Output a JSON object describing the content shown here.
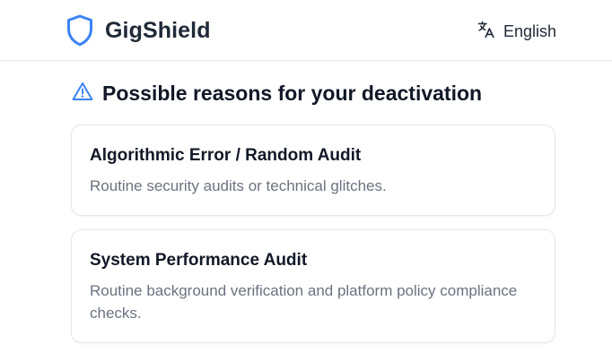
{
  "header": {
    "brand_name": "GigShield",
    "brand_icon": "shield-icon",
    "language_icon": "translate-icon",
    "language_label": "English"
  },
  "section": {
    "icon": "warning-icon",
    "title": "Possible reasons for your deactivation"
  },
  "reasons": [
    {
      "title": "Algorithmic Error / Random Audit",
      "description": "Routine security audits or technical glitches."
    },
    {
      "title": "System Performance Audit",
      "description": "Routine background verification and platform policy compliance checks."
    }
  ],
  "colors": {
    "accent": "#3b82f6",
    "text_primary": "#111827",
    "text_secondary": "#6b7280",
    "border": "#e5e7eb"
  }
}
